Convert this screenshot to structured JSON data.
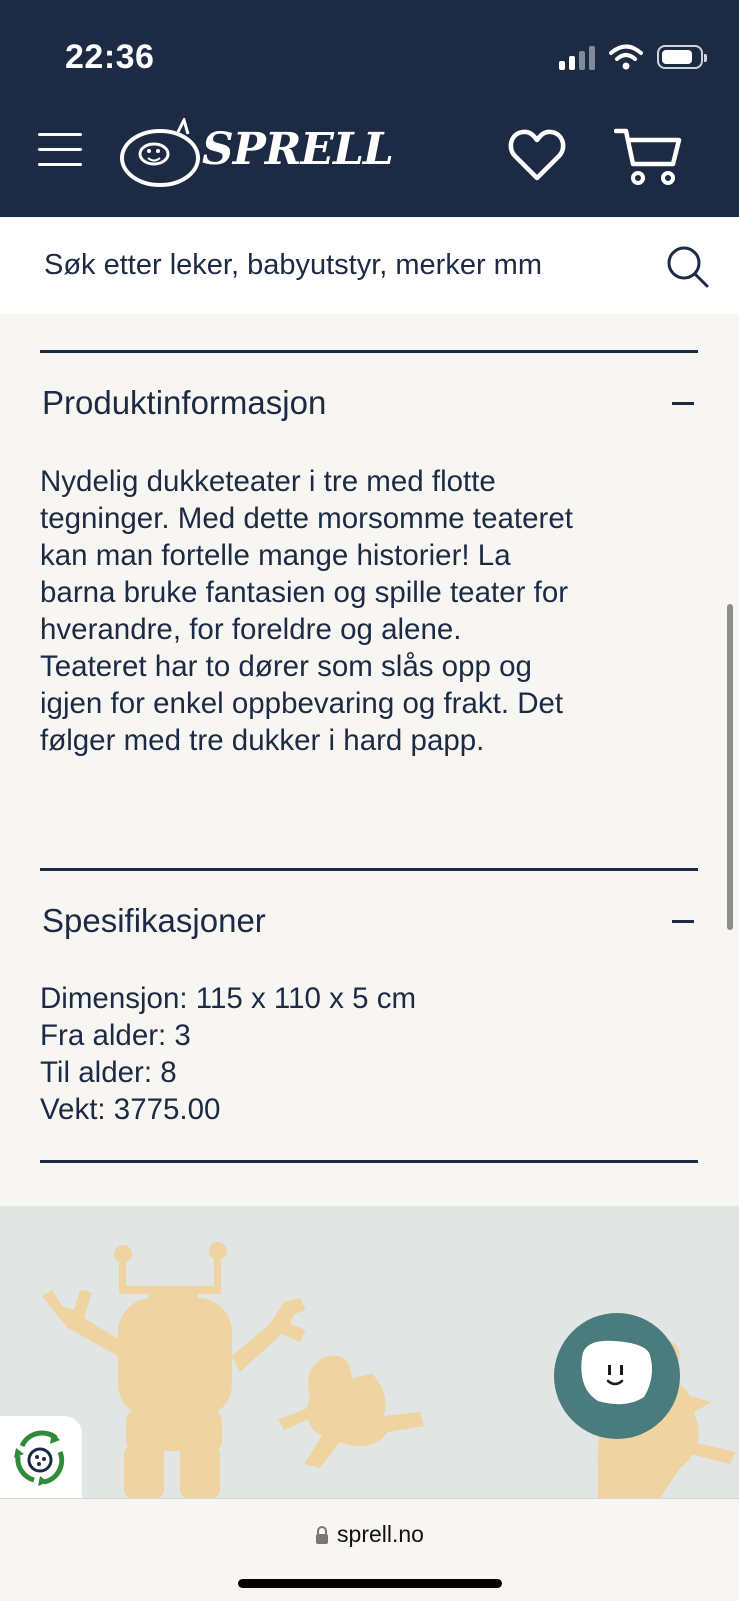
{
  "status_bar": {
    "time": "22:36"
  },
  "header": {
    "brand": "SPRELL",
    "icons": {
      "menu": "hamburger-icon",
      "logo": "sprell-logo",
      "wishlist": "heart-icon",
      "cart": "cart-icon"
    }
  },
  "search": {
    "placeholder": "Søk etter leker, babyutstyr, merker mm",
    "icon": "search-icon"
  },
  "product_info": {
    "title": "Produktinformasjon",
    "toggle": "−",
    "paragraphs": [
      "Nydelig dukketeater i tre med flotte tegninger. Med dette morsomme teateret kan man fortelle mange historier! La barna bruke fantasien og spille teater for hverandre, for foreldre og alene.",
      "Teateret har to dører som slås opp og igjen for enkel oppbevaring og frakt. Det følger med tre dukker i hard papp."
    ]
  },
  "specifications": {
    "title": "Spesifikasjoner",
    "toggle": "−",
    "lines": [
      "Dimensjon: 115 x 110 x 5 cm",
      "Fra alder: 3",
      "Til alder: 8",
      "Vekt: 3775.00"
    ]
  },
  "browser": {
    "url": "sprell.no"
  },
  "colors": {
    "navy": "#1d2a44",
    "background": "#f7f6f3",
    "illustration_bg": "#e1e6e5",
    "figure_tan": "#efd3a0",
    "chat_teal": "#4a7b7d"
  }
}
